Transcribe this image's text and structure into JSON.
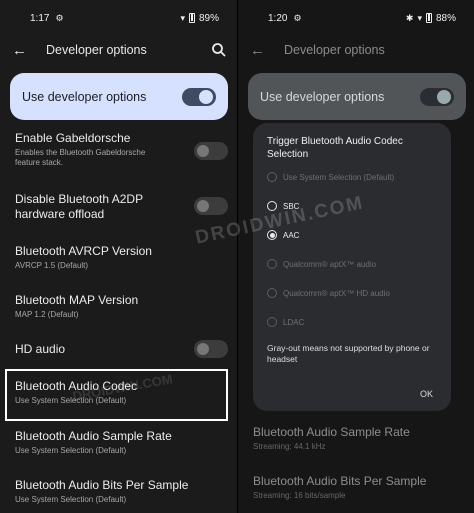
{
  "left": {
    "status": {
      "time": "1:17",
      "battery": "89%"
    },
    "topbar": {
      "title": "Developer options"
    },
    "master": {
      "label": "Use developer options"
    },
    "items": [
      {
        "title": "Enable Gabeldorsche",
        "subtitle": "Enables the Bluetooth Gabeldorsche feature stack."
      },
      {
        "title": "Disable Bluetooth A2DP hardware offload",
        "subtitle": ""
      },
      {
        "title": "Bluetooth AVRCP Version",
        "subtitle": "AVRCP 1.5 (Default)"
      },
      {
        "title": "Bluetooth MAP Version",
        "subtitle": "MAP 1.2 (Default)"
      },
      {
        "title": "HD audio",
        "subtitle": ""
      },
      {
        "title": "Bluetooth Audio Codec",
        "subtitle": "Use System Selection (Default)"
      },
      {
        "title": "Bluetooth Audio Sample Rate",
        "subtitle": "Use System Selection (Default)"
      },
      {
        "title": "Bluetooth Audio Bits Per Sample",
        "subtitle": "Use System Selection (Default)"
      }
    ]
  },
  "right": {
    "status": {
      "time": "1:20",
      "battery": "88%"
    },
    "topbar": {
      "title": "Developer options"
    },
    "master": {
      "label": "Use developer options"
    },
    "background_items": [
      {
        "title": "Bluetooth Audio Sample Rate",
        "subtitle": "Streaming: 44.1 kHz"
      },
      {
        "title": "Bluetooth Audio Bits Per Sample",
        "subtitle": "Streaming: 16 bits/sample"
      }
    ],
    "dialog": {
      "title": "Trigger Bluetooth Audio Codec Selection",
      "options": [
        {
          "label": "Use System Selection (Default)",
          "enabled": false,
          "checked": false
        },
        {
          "label": "SBC",
          "enabled": true,
          "checked": false
        },
        {
          "label": "AAC",
          "enabled": true,
          "checked": true
        },
        {
          "label": "Qualcomm® aptX™ audio",
          "enabled": false,
          "checked": false
        },
        {
          "label": "Qualcomm® aptX™ HD audio",
          "enabled": false,
          "checked": false
        },
        {
          "label": "LDAC",
          "enabled": false,
          "checked": false
        }
      ],
      "note": "Gray-out means not supported by phone or headset",
      "ok_label": "OK"
    }
  },
  "watermark": {
    "text": "DROIDWIN.COM",
    "small_text": "DROIDWIN.COM"
  },
  "colors": {
    "accent_card": "#d5e1ff",
    "highlight_border": "#ffffff"
  }
}
